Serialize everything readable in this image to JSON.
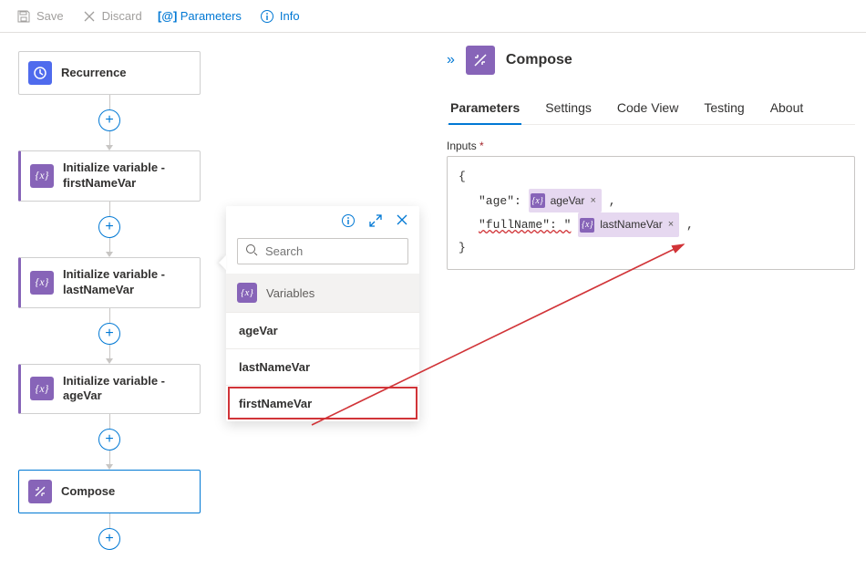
{
  "toolbar": {
    "save": "Save",
    "discard": "Discard",
    "parameters": "Parameters",
    "info": "Info"
  },
  "flow": {
    "recurrence": "Recurrence",
    "init_first": "Initialize variable - firstNameVar",
    "init_last": "Initialize variable - lastNameVar",
    "init_age": "Initialize variable - ageVar",
    "compose": "Compose"
  },
  "flyout": {
    "search_placeholder": "Search",
    "category": "Variables",
    "items": [
      "ageVar",
      "lastNameVar",
      "firstNameVar"
    ]
  },
  "panel": {
    "title": "Compose",
    "tabs": {
      "parameters": "Parameters",
      "settings": "Settings",
      "code": "Code View",
      "testing": "Testing",
      "about": "About"
    },
    "inputs_label": "Inputs",
    "json": {
      "open": "{",
      "age_key": "\"age\":",
      "comma": ",",
      "fullname_key": "\"fullName\": \"",
      "close": "}"
    },
    "tokens": {
      "ageVar": "ageVar",
      "lastNameVar": "lastNameVar"
    }
  }
}
